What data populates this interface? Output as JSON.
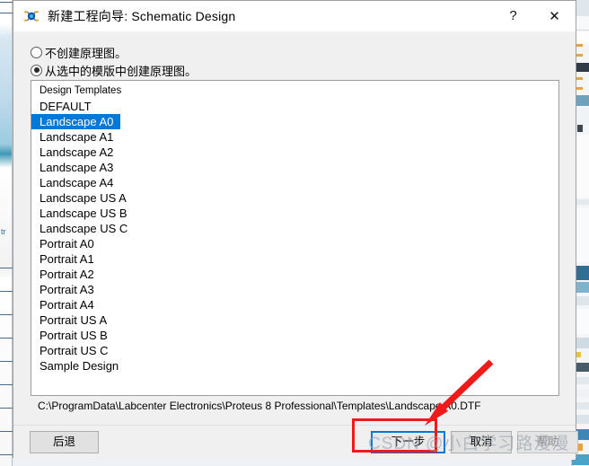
{
  "window": {
    "title": "新建工程向导: Schematic Design",
    "icon": "proteus-app-icon",
    "help_button": "?",
    "close_button": "✕"
  },
  "options": [
    {
      "label": "不创建原理图。",
      "selected": false
    },
    {
      "label": "从选中的模版中创建原理图。",
      "selected": true
    }
  ],
  "list": {
    "header": "Design Templates",
    "items": [
      {
        "label": "DEFAULT",
        "selected": false
      },
      {
        "label": "Landscape A0",
        "selected": true
      },
      {
        "label": "Landscape A1",
        "selected": false
      },
      {
        "label": "Landscape A2",
        "selected": false
      },
      {
        "label": "Landscape A3",
        "selected": false
      },
      {
        "label": "Landscape A4",
        "selected": false
      },
      {
        "label": "Landscape US A",
        "selected": false
      },
      {
        "label": "Landscape US B",
        "selected": false
      },
      {
        "label": "Landscape US C",
        "selected": false
      },
      {
        "label": "Portrait A0",
        "selected": false
      },
      {
        "label": "Portrait A1",
        "selected": false
      },
      {
        "label": "Portrait A2",
        "selected": false
      },
      {
        "label": "Portrait A3",
        "selected": false
      },
      {
        "label": "Portrait A4",
        "selected": false
      },
      {
        "label": "Portrait US A",
        "selected": false
      },
      {
        "label": "Portrait US B",
        "selected": false
      },
      {
        "label": "Portrait US C",
        "selected": false
      },
      {
        "label": "Sample Design",
        "selected": false
      }
    ]
  },
  "path": "C:\\ProgramData\\Labcenter Electronics\\Proteus 8 Professional\\Templates\\Landscape A0.DTF",
  "buttons": {
    "back": "后退",
    "next": "下一步",
    "cancel": "取消",
    "help": "帮助"
  },
  "annotations": {
    "watermark": "CSDN @小白学习路漫漫",
    "highlight_color": "#ef1b1b",
    "focus_color": "#0078d7",
    "selection_color": "#0078d7"
  },
  "background": {
    "left_text": "tr"
  }
}
